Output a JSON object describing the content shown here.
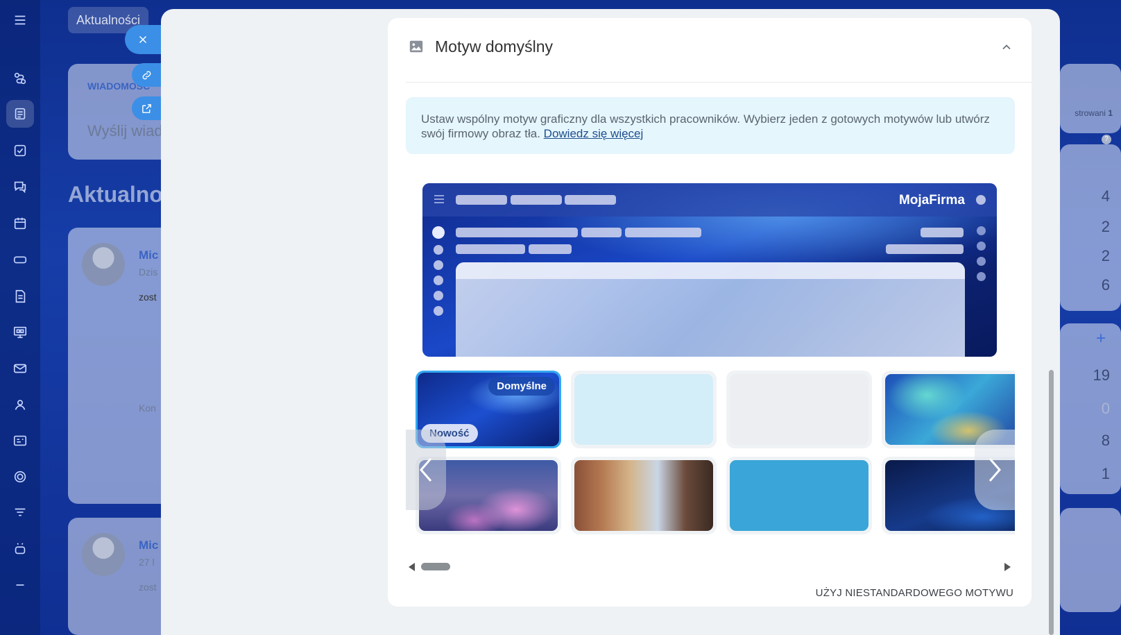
{
  "background": {
    "tab_label": "Aktualności",
    "compose_tab": "WIADOMOŚĆ",
    "compose_placeholder": "Wyślij wiad",
    "feed_title": "Aktualnoś",
    "post1_author": "Mic",
    "post1_time": "Dzis",
    "post1_text": "zost",
    "post1_comment": "Kon",
    "post2_author": "Mic",
    "post2_time": "27 l",
    "post2_text": "zost",
    "right_panel_text": "strowani",
    "right_panel_count": "1",
    "help_icon": "?",
    "right_numbers": [
      "4",
      "2",
      "2",
      "6"
    ],
    "right_plus": "+",
    "right_numbers_2": [
      "19",
      "0",
      "8",
      "1"
    ]
  },
  "rail": {
    "icons": [
      "hamburger-icon",
      "routes-icon",
      "feed-icon",
      "tasks-icon",
      "chat-icon",
      "calendar-icon",
      "drive-icon",
      "docs-icon",
      "boards-icon",
      "mail-icon",
      "contacts-icon",
      "crm-icon",
      "target-icon",
      "filter-icon",
      "robot-icon",
      "more-icon"
    ]
  },
  "slider": {
    "card": {
      "title": "Motyw domyślny",
      "info_text": "Ustaw wspólny motyw graficzny dla wszystkich pracowników. Wybierz jeden z gotowych motywów lub utwórz swój firmowy obraz tła.",
      "info_link": "Dowiedz się więcej",
      "preview_brand": "MojaFirma",
      "badge_default": "Domyślne",
      "badge_new": "Nowość",
      "custom_theme": "UŻYJ NIESTANDARDOWEGO MOTYWU"
    }
  },
  "colors": {
    "accent": "#3b8fe6",
    "selected_border": "#35a8f0",
    "info_bg": "#e5f6fd",
    "link": "#1f4e8c"
  }
}
